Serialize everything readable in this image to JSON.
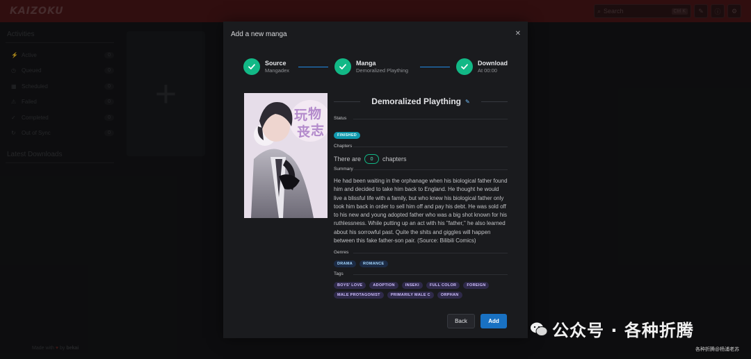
{
  "app": {
    "logo": "KAIZOKU"
  },
  "search": {
    "placeholder": "Search",
    "shortcut": "Ctrl K"
  },
  "sidebar": {
    "activities_label": "Activities",
    "items": [
      {
        "label": "Active",
        "count": "0",
        "icon": "activity-icon"
      },
      {
        "label": "Queued",
        "count": "0",
        "icon": "clock-icon"
      },
      {
        "label": "Scheduled",
        "count": "0",
        "icon": "calendar-icon"
      },
      {
        "label": "Failed",
        "count": "0",
        "icon": "alert-icon"
      },
      {
        "label": "Completed",
        "count": "0",
        "icon": "check-icon"
      },
      {
        "label": "Out of Sync",
        "count": "0",
        "icon": "refresh-icon"
      }
    ],
    "latest_downloads_label": "Latest Downloads",
    "footer_prefix": "Made with",
    "footer_suffix": "by",
    "footer_author": "bekai"
  },
  "modal": {
    "title": "Add a new manga",
    "steps": [
      {
        "label": "Source",
        "description": "Mangadex"
      },
      {
        "label": "Manga",
        "description": "Demoralized Plaything"
      },
      {
        "label": "Download",
        "description": "At 00:00"
      }
    ],
    "manga": {
      "title": "Demoralized Plaything",
      "status_label": "Status",
      "status": "FINISHED",
      "chapters_label": "Chapters",
      "chapters_prefix": "There are",
      "chapters_count": "0",
      "chapters_suffix": "chapters",
      "summary_label": "Summary",
      "summary": "He had been waiting in the orphanage when his biological father found him and decided to take him back to England. He thought he would live a blissful life with a family, but who knew his biological father only took him back in order to sell him off and pay his debt. He was sold off to his new and young adopted father who was a big shot known for his ruthlessness. While putting up an act with his \"father,\" he also learned about his sorrowful past. Quite the shits and giggles will happen between this fake father-son pair. (Source: Bilibili Comics)",
      "genres_label": "Genres",
      "genres": [
        "DRAMA",
        "ROMANCE"
      ],
      "tags_label": "Tags",
      "tags": [
        "BOYS' LOVE",
        "ADOPTION",
        "INSEKI",
        "FULL COLOR",
        "FOREIGN",
        "MALE PROTAGONIST",
        "PRIMARILY MALE C",
        "ORPHAN"
      ],
      "cover_title_text": "玩物丧志"
    },
    "back_label": "Back",
    "add_label": "Add"
  },
  "watermark": {
    "text": "公众号 · 各种折腾",
    "sub": "各种折腾@杨浦老苏"
  },
  "colors": {
    "accent_green": "#12b886",
    "primary_blue": "#1971c2",
    "topbar": "#4a1618"
  }
}
